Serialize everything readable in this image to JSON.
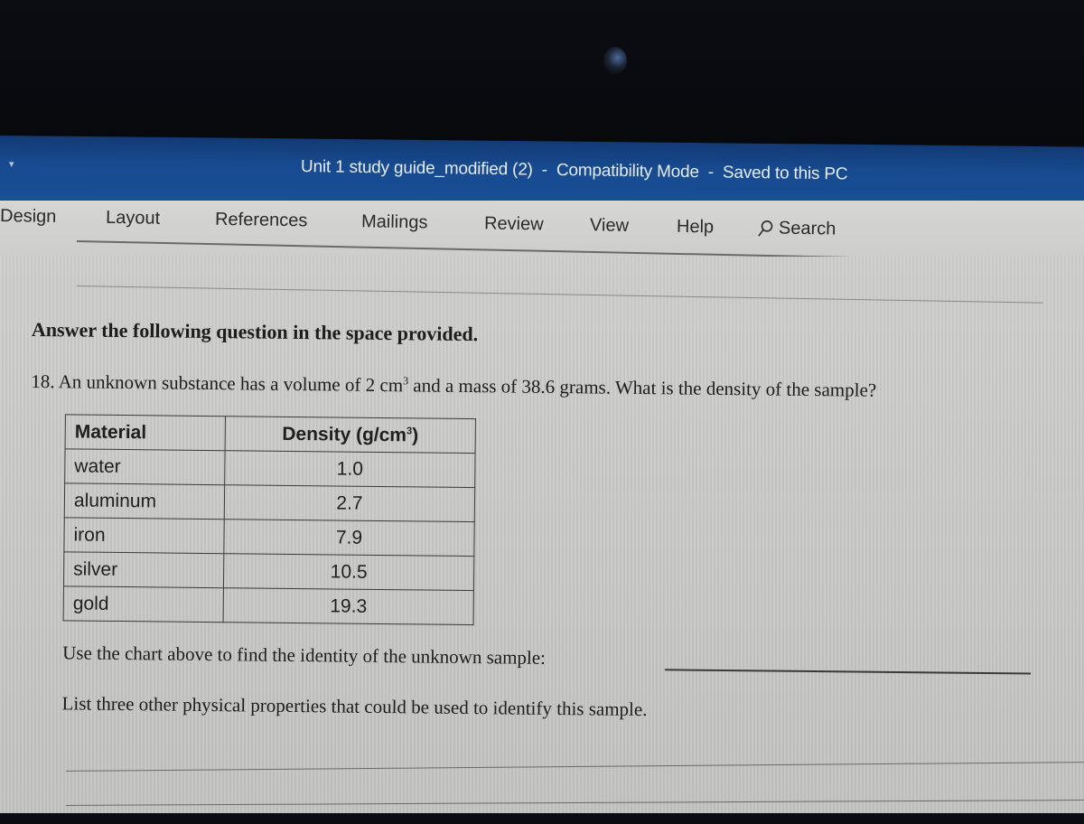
{
  "window": {
    "title": "Unit 1 study guide_modified (2)",
    "mode": "Compatibility Mode",
    "save_status": "Saved to this PC",
    "separator": "-"
  },
  "ribbon": {
    "tabs": [
      {
        "label": "Design"
      },
      {
        "label": "Layout"
      },
      {
        "label": "References"
      },
      {
        "label": "Mailings"
      },
      {
        "label": "Review"
      },
      {
        "label": "View"
      },
      {
        "label": "Help"
      }
    ],
    "search_label": "Search",
    "search_icon": "search-icon"
  },
  "document": {
    "instruction": "Answer the following question in the space provided.",
    "question": {
      "number": "18.",
      "text_before": "An unknown substance has a volume of 2 cm",
      "superscript": "3",
      "text_after": " and a mass of 38.6 grams. What is the density of the sample?"
    },
    "table": {
      "headers": {
        "material": "Material",
        "density": "Density (g/cm",
        "density_sup": "3",
        "density_close": ")"
      },
      "rows": [
        {
          "material": "water",
          "density": "1.0"
        },
        {
          "material": "aluminum",
          "density": "2.7"
        },
        {
          "material": "iron",
          "density": "7.9"
        },
        {
          "material": "silver",
          "density": "10.5"
        },
        {
          "material": "gold",
          "density": "19.3"
        }
      ]
    },
    "identify_prompt": "Use the chart above to find the identity of the unknown sample:",
    "properties_prompt": "List three other physical properties that could be used to identify this sample."
  }
}
